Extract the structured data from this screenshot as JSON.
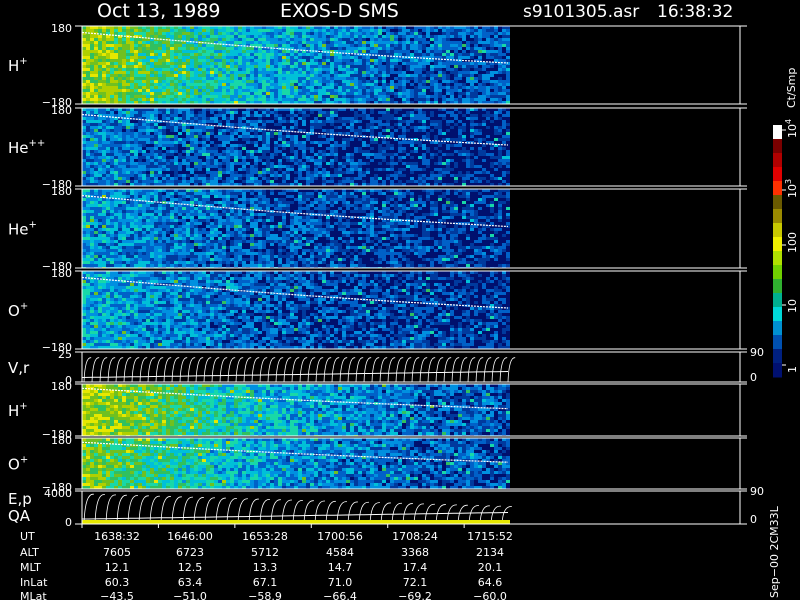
{
  "chart_data": {
    "type": "heatmap",
    "title": {
      "date": "Oct 13, 1989",
      "instrument": "EXOS-D SMS",
      "file": "s9101305.asr",
      "time": "16:38:32"
    },
    "panels": [
      {
        "id": "h1",
        "label": "H",
        "sup": "+",
        "y_ticks": [
          "180",
          "−180"
        ],
        "intensity": 0.55
      },
      {
        "id": "he2",
        "label": "He",
        "sup": "++",
        "y_ticks": [
          "180",
          "−180"
        ],
        "intensity": 0.18
      },
      {
        "id": "he1",
        "label": "He",
        "sup": "+",
        "y_ticks": [
          "180",
          "−180"
        ],
        "intensity": 0.22
      },
      {
        "id": "o1",
        "label": "O",
        "sup": "+",
        "y_ticks": [
          "180",
          "−180"
        ],
        "intensity": 0.25
      },
      {
        "id": "vr",
        "label": "V,r",
        "sup": "",
        "y_ticks": [
          "25",
          "0"
        ],
        "right_ticks": [
          "90",
          "0"
        ],
        "intensity": 0
      },
      {
        "id": "h2",
        "label": "H",
        "sup": "+",
        "y_ticks": [
          "180",
          "−180"
        ],
        "intensity": 0.6
      },
      {
        "id": "o2",
        "label": "O",
        "sup": "+",
        "y_ticks": [
          "180",
          "−180"
        ],
        "intensity": 0.5
      },
      {
        "id": "ep",
        "label": "E,p",
        "sup": "",
        "label2": "QA",
        "y_ticks": [
          "4000",
          "0"
        ],
        "right_ticks": [
          "90",
          "0"
        ],
        "intensity": 0
      }
    ],
    "colorbar": {
      "unit": "Ct/Smp",
      "ticks": [
        {
          "base": "10",
          "exp": "4"
        },
        {
          "base": "10",
          "exp": "3"
        },
        {
          "base": "100",
          "exp": ""
        },
        {
          "base": "10",
          "exp": ""
        },
        {
          "base": "1",
          "exp": ""
        }
      ]
    },
    "ephemeris": {
      "labels": [
        "UT",
        "ALT",
        "MLT",
        "InLat",
        "MLat"
      ],
      "columns": [
        [
          "1638:32",
          "7605",
          "12.1",
          "60.3",
          "−43.5"
        ],
        [
          "1646:00",
          "6723",
          "12.5",
          "63.4",
          "−51.0"
        ],
        [
          "1653:28",
          "5712",
          "13.3",
          "67.1",
          "−58.9"
        ],
        [
          "1700:56",
          "4584",
          "14.7",
          "71.0",
          "−66.4"
        ],
        [
          "1708:24",
          "3368",
          "17.4",
          "72.1",
          "−69.2"
        ],
        [
          "1715:52",
          "2134",
          "20.1",
          "64.6",
          "−60.0"
        ]
      ]
    },
    "footer": "Sep−00 2CM33L"
  }
}
